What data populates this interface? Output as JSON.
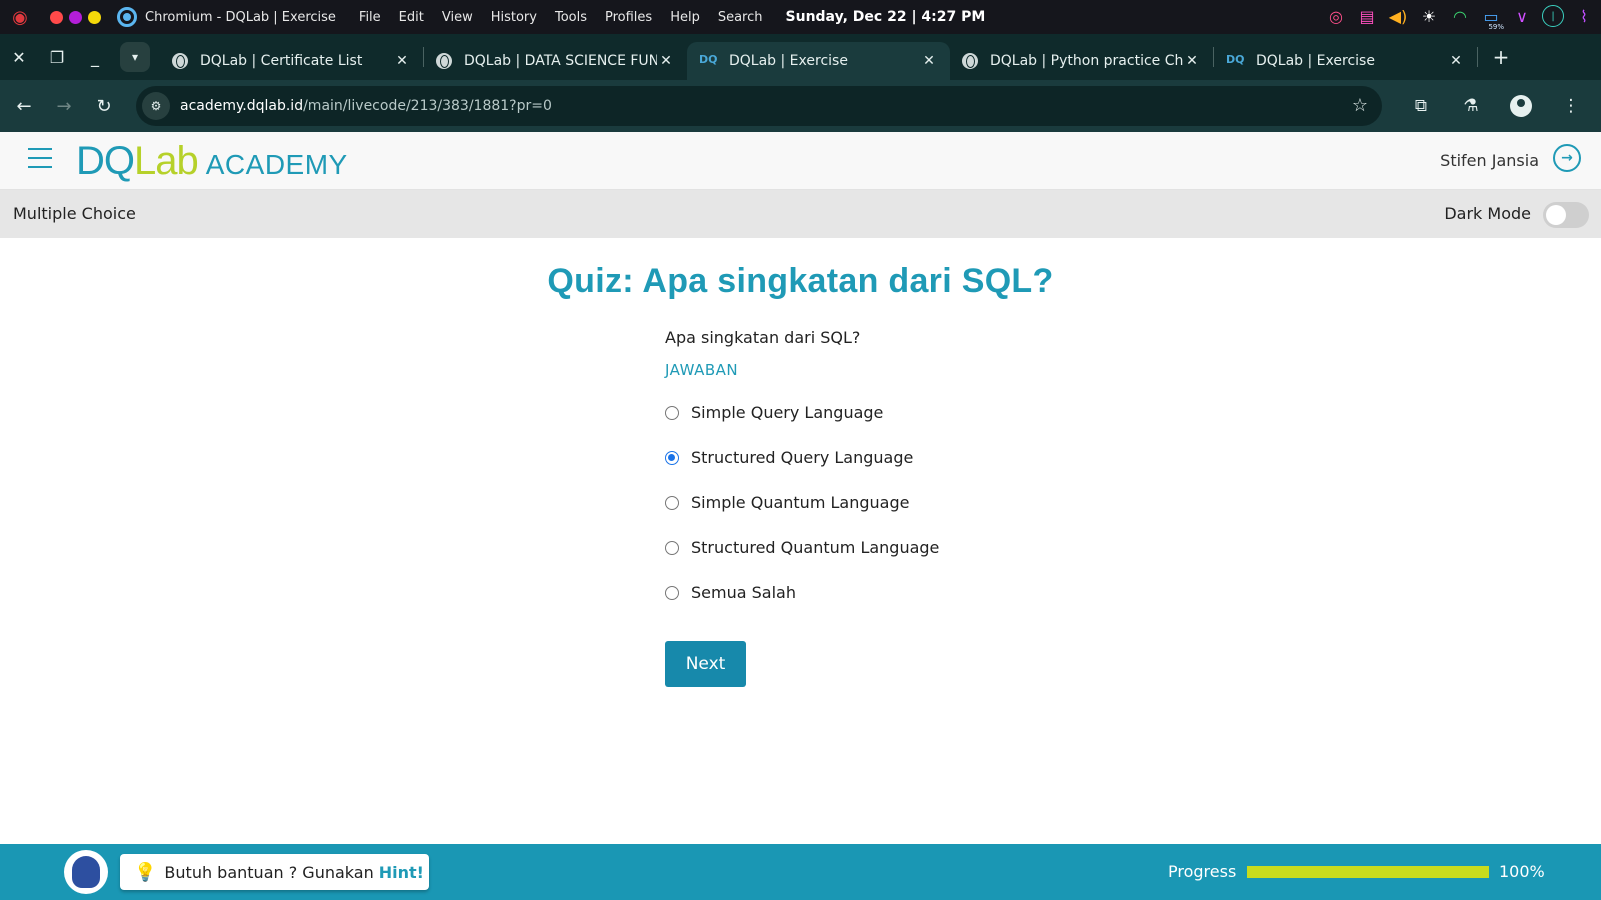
{
  "os_bar": {
    "app_title": "Chromium - DQLab | Exercise",
    "menu": [
      "File",
      "Edit",
      "View",
      "History",
      "Tools",
      "Profiles",
      "Help",
      "Search"
    ],
    "clock": "Sunday, Dec 22 | 4:27 PM",
    "battery_label": "59%"
  },
  "tabs": [
    {
      "label": "DQLab | Certificate List",
      "icon": "globe-icon",
      "active": false
    },
    {
      "label": "DQLab | DATA SCIENCE FUND",
      "icon": "globe-icon",
      "active": false
    },
    {
      "label": "DQLab | Exercise",
      "icon": "dqlab-icon",
      "active": true
    },
    {
      "label": "DQLab | Python practice Cha",
      "icon": "globe-icon",
      "active": false
    },
    {
      "label": "DQLab | Exercise",
      "icon": "dqlab-icon",
      "active": false
    }
  ],
  "address": {
    "host": "academy.dqlab.id",
    "path": "/main/livecode/213/383/1881?pr=0"
  },
  "header": {
    "logo_dq": "DQ",
    "logo_lab": "Lab",
    "logo_academy": "ACADEMY",
    "user_name": "Stifen Jansia"
  },
  "sub_bar": {
    "title": "Multiple Choice",
    "dark_mode_label": "Dark Mode",
    "dark_mode_on": false
  },
  "quiz": {
    "title": "Quiz: Apa singkatan dari SQL?",
    "question": "Apa singkatan dari SQL?",
    "answer_label": "JAWABAN",
    "options": [
      {
        "label": "Simple Query Language",
        "selected": false
      },
      {
        "label": "Structured Query Language",
        "selected": true
      },
      {
        "label": "Simple Quantum Language",
        "selected": false
      },
      {
        "label": "Structured Quantum Language",
        "selected": false
      },
      {
        "label": "Semua Salah",
        "selected": false
      }
    ],
    "next_label": "Next"
  },
  "footer": {
    "hint_text": "Butuh bantuan ? Gunakan",
    "hint_link": "Hint!",
    "progress_label": "Progress",
    "progress_value": 1.0,
    "progress_text": "100%"
  },
  "colors": {
    "brand": "#1f9ab6",
    "brand_lime": "#b6d12a",
    "progress_fill": "#c8dc1e",
    "footer_bg": "#1a97b4"
  }
}
